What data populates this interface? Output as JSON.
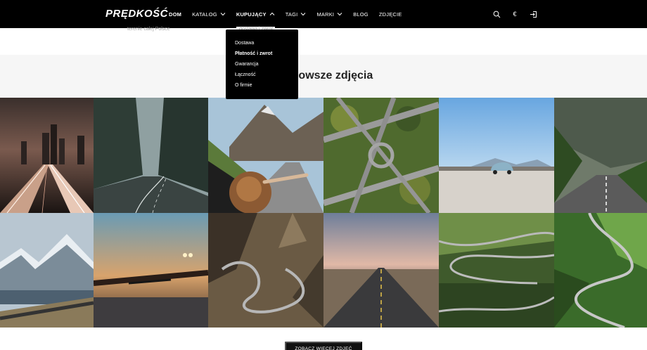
{
  "brand": {
    "logo": "PRĘDKOŚĆ"
  },
  "nav": {
    "items": [
      {
        "label": "DOM",
        "chevron": false
      },
      {
        "label": "KATALOG",
        "chevron": true,
        "chevron_dir": "down"
      },
      {
        "label": "KUPUJĄCY",
        "chevron": true,
        "chevron_dir": "up"
      },
      {
        "label": "TAGI",
        "chevron": true,
        "chevron_dir": "down"
      },
      {
        "label": "MARKI",
        "chevron": true,
        "chevron_dir": "down"
      },
      {
        "label": "BLOG",
        "chevron": false
      },
      {
        "label": "ZDJĘCIE",
        "chevron": false
      }
    ],
    "active_index": 2
  },
  "header_icons": [
    "search-icon",
    "euro-icon",
    "login-icon"
  ],
  "currency_symbol": "€",
  "strip": {
    "left_text": "terenie całej Polsce",
    "right_text": "dostawa i zwrot"
  },
  "dropdown": {
    "items": [
      {
        "label": "Dostawa",
        "bold": false
      },
      {
        "label": "Płatność i zwrot",
        "bold": true
      },
      {
        "label": "Gwarancja",
        "bold": false
      },
      {
        "label": "Łączność",
        "bold": false
      },
      {
        "label": "O firmie",
        "bold": false
      }
    ]
  },
  "section": {
    "title": "Najnowsze zdjęcia"
  },
  "gallery": {
    "tiles": [
      "city-night-traffic-photo",
      "foggy-forest-road-photo",
      "car-window-mountain-road-photo",
      "highway-interchange-aerial-photo",
      "vintage-car-salt-flat-photo",
      "mountain-valley-road-photo",
      "snowy-mountains-road-photo",
      "windshield-sunset-road-photo",
      "winding-canyon-road-aerial-photo",
      "straight-road-dusk-photo",
      "serpentine-road-forest-aerial-photo",
      "winding-road-green-aerial-photo"
    ]
  },
  "more_button": {
    "label": "ZOBACZ WIĘCEJ ZDJĘĆ"
  }
}
